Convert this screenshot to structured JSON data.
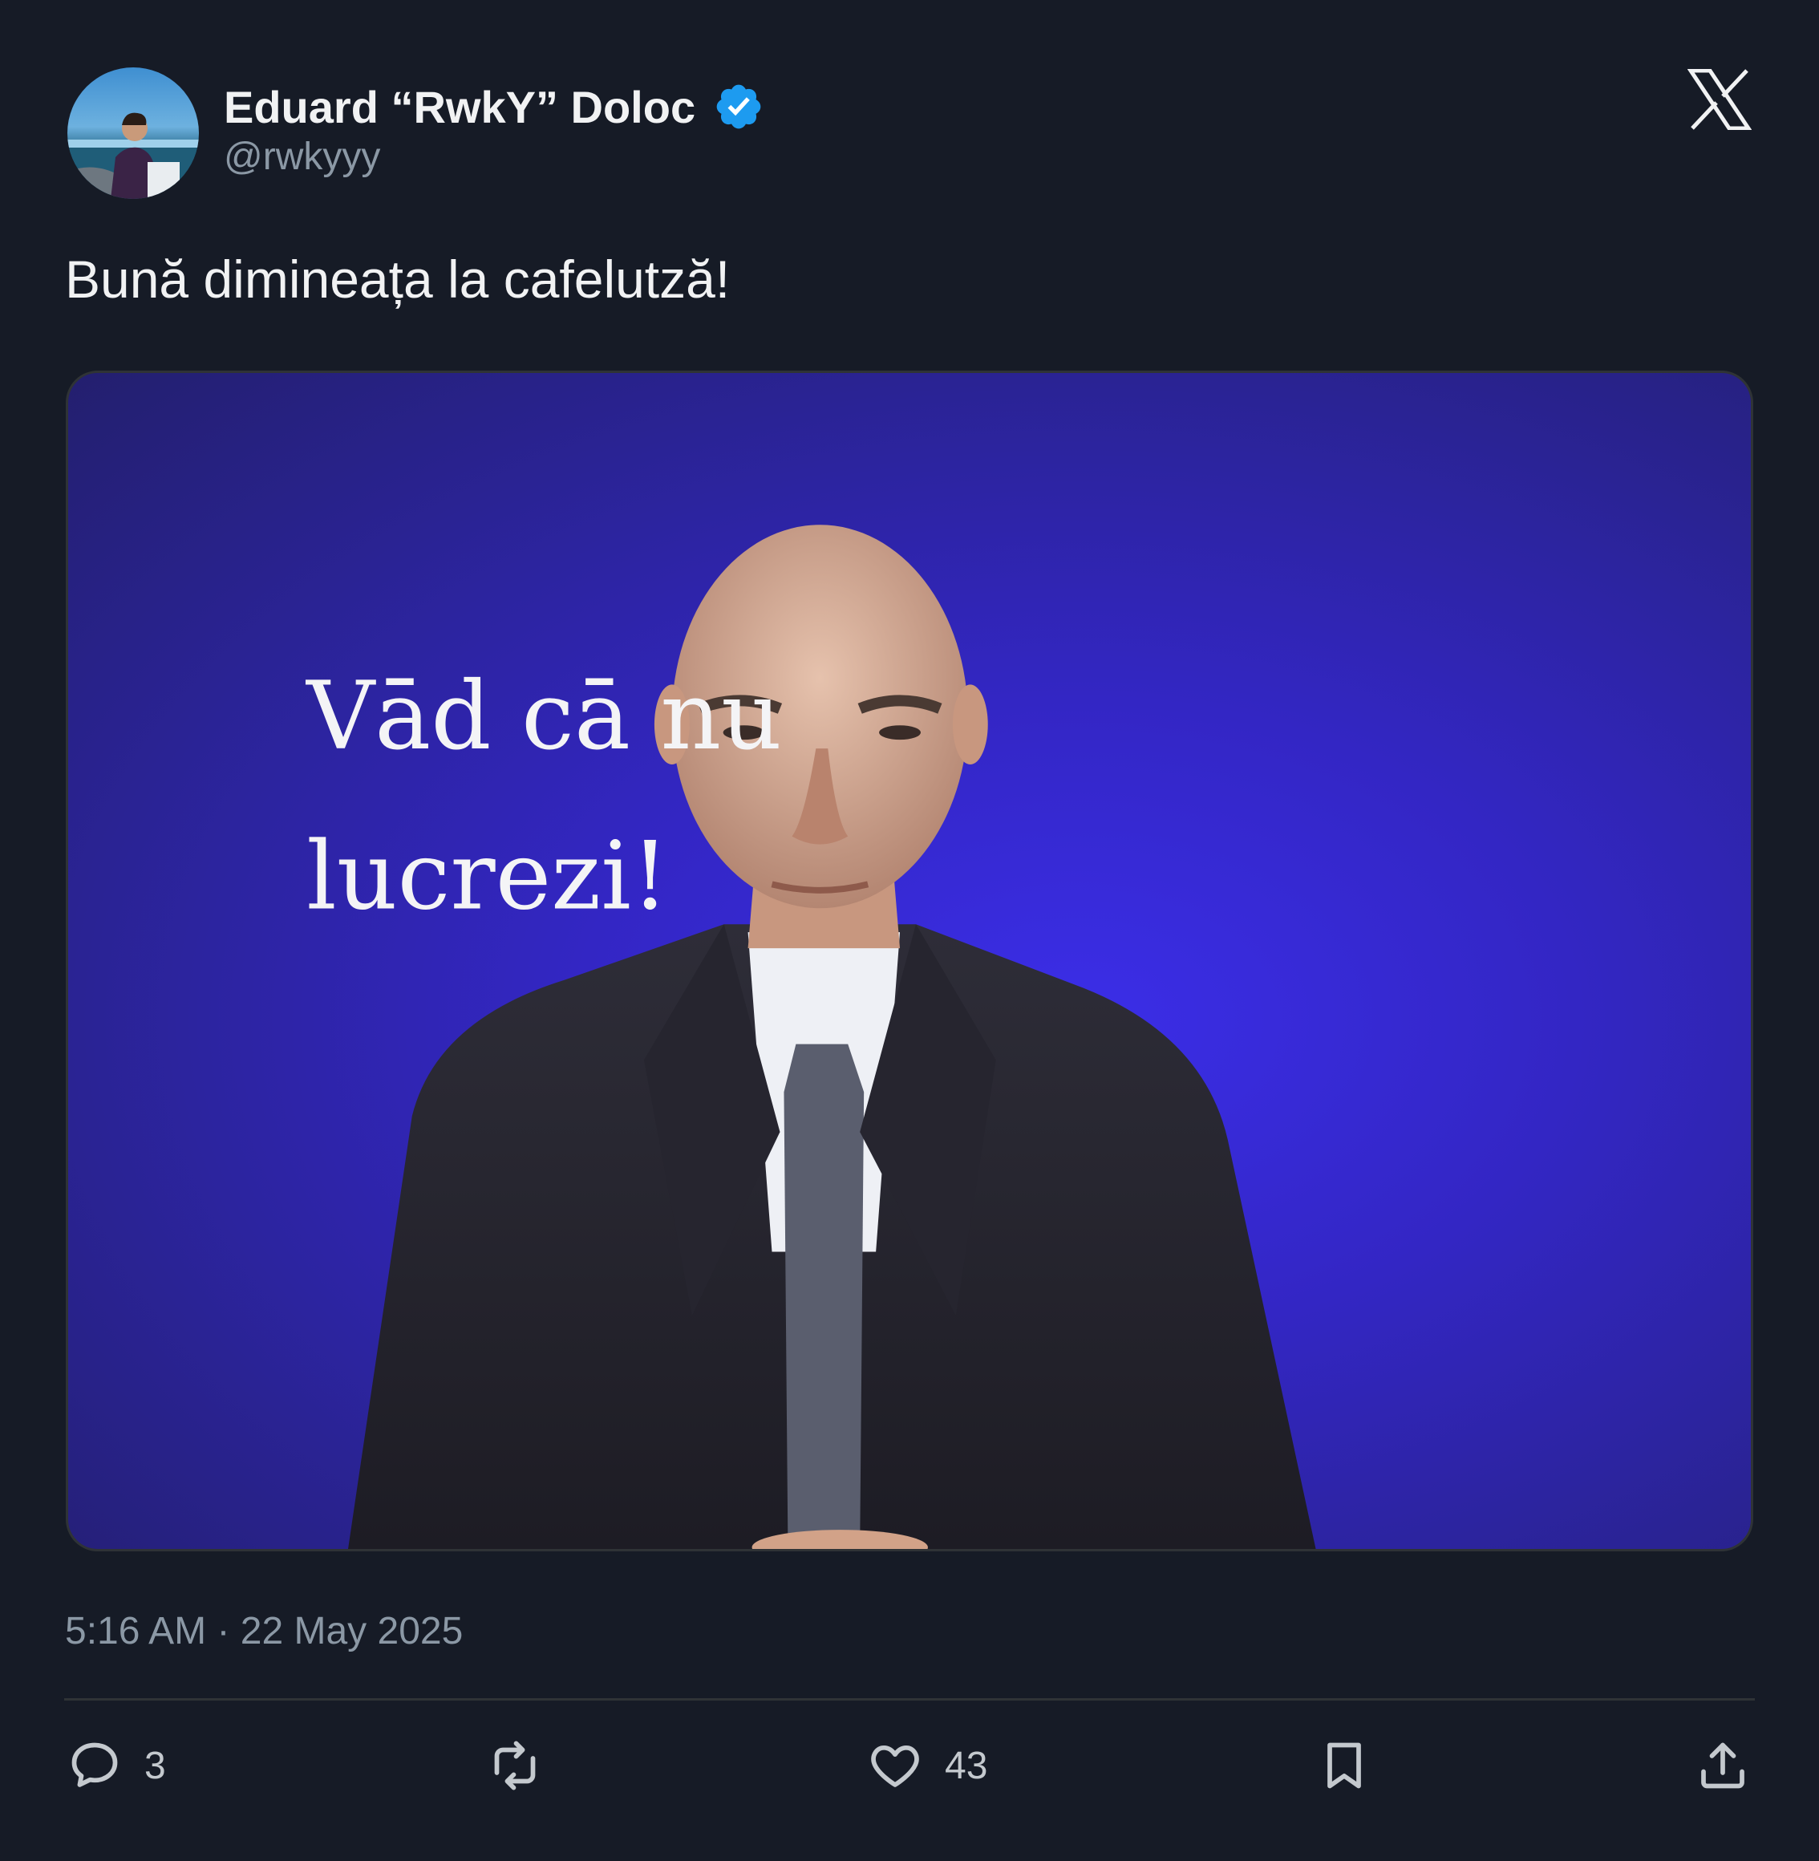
{
  "author": {
    "display_name": "Eduard “RwkY” Doloc",
    "handle": "@rwkyyy",
    "verified": true,
    "verified_color": "#1d9bf0"
  },
  "brand": {
    "logo": "x-logo-icon"
  },
  "tweet": {
    "text": "Bună dimineața la cafelutză!",
    "image": {
      "overlay_line1": "Vād cā nu",
      "overlay_line2": "lucrezi!",
      "background_color": "#3326c4"
    },
    "timestamp": "5:16 AM · 22 May 2025"
  },
  "actions": {
    "reply": {
      "icon": "reply-icon",
      "count": "3"
    },
    "retweet": {
      "icon": "retweet-icon",
      "count": ""
    },
    "like": {
      "icon": "heart-icon",
      "count": "43"
    },
    "bookmark": {
      "icon": "bookmark-icon"
    },
    "share": {
      "icon": "share-icon"
    }
  },
  "colors": {
    "background": "#161b26",
    "text": "#e7e9ea",
    "muted": "#8b98a5",
    "divider": "#2f3336"
  }
}
